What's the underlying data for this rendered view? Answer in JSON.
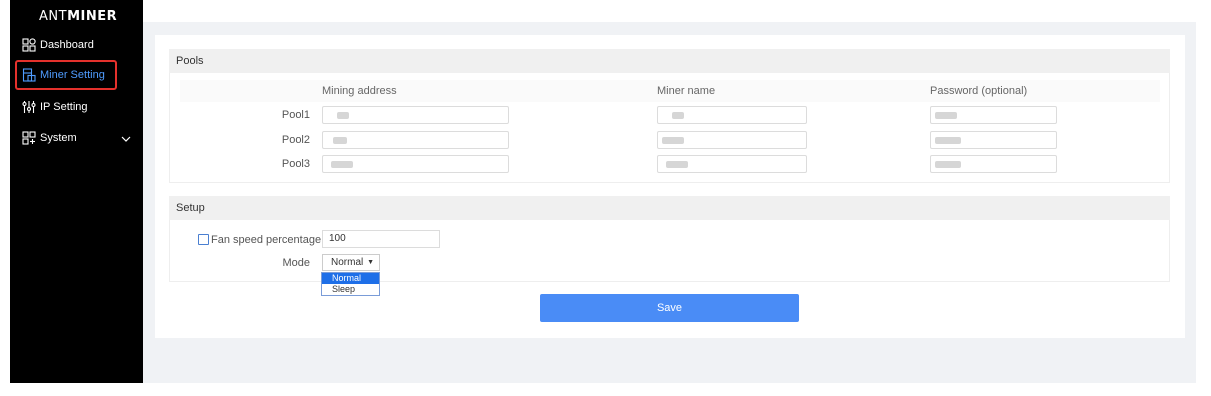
{
  "app": {
    "logo_prefix": "ANT",
    "logo_suffix": "MINER"
  },
  "sidebar": {
    "items": [
      {
        "label": "Dashboard",
        "icon": "dashboard-icon"
      },
      {
        "label": "Miner Setting",
        "icon": "miner-setting-icon",
        "active": true
      },
      {
        "label": "IP Setting",
        "icon": "ip-setting-icon"
      },
      {
        "label": "System",
        "icon": "system-icon",
        "expandable": true
      }
    ]
  },
  "pools": {
    "title": "Pools",
    "columns": [
      "Mining address",
      "Miner name",
      "Password (optional)"
    ],
    "rows": [
      {
        "label": "Pool1"
      },
      {
        "label": "Pool2"
      },
      {
        "label": "Pool3"
      }
    ]
  },
  "setup": {
    "title": "Setup",
    "fan_label": "Fan speed percentage",
    "fan_checked": false,
    "fan_value": "100",
    "mode_label": "Mode",
    "mode_value": "Normal",
    "mode_options": [
      "Normal",
      "Sleep"
    ]
  },
  "save_label": "Save",
  "colors": {
    "accent": "#4a8cf6",
    "active_nav": "#4f9cff",
    "highlight_outline": "#e5312c",
    "sidebar_bg": "#000000"
  }
}
